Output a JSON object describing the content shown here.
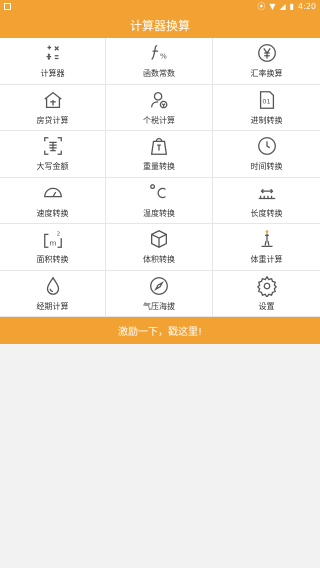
{
  "status_bar": {
    "time": "4:20"
  },
  "header": {
    "title": "计算器换算"
  },
  "tools": [
    {
      "label": "计算器",
      "icon": "calculator-icon"
    },
    {
      "label": "函数常数",
      "icon": "function-icon"
    },
    {
      "label": "汇率换算",
      "icon": "currency-yen-icon"
    },
    {
      "label": "房贷计算",
      "icon": "house-loan-icon"
    },
    {
      "label": "个税计算",
      "icon": "person-tax-icon"
    },
    {
      "label": "进制转换",
      "icon": "binary-icon"
    },
    {
      "label": "大写金额",
      "icon": "uppercase-amount-icon"
    },
    {
      "label": "重量转换",
      "icon": "weight-icon"
    },
    {
      "label": "时间转换",
      "icon": "clock-icon"
    },
    {
      "label": "速度转换",
      "icon": "speedometer-icon"
    },
    {
      "label": "温度转换",
      "icon": "temperature-icon"
    },
    {
      "label": "长度转换",
      "icon": "ruler-icon"
    },
    {
      "label": "面积转换",
      "icon": "area-icon"
    },
    {
      "label": "体积转换",
      "icon": "cube-icon"
    },
    {
      "label": "体重计算",
      "icon": "body-weight-icon"
    },
    {
      "label": "经期计算",
      "icon": "drop-icon"
    },
    {
      "label": "气压海拔",
      "icon": "compass-icon"
    },
    {
      "label": "设置",
      "icon": "gear-icon"
    }
  ],
  "banner": {
    "text": "激励一下，戳这里!"
  },
  "colors": {
    "accent": "#f2a233"
  }
}
